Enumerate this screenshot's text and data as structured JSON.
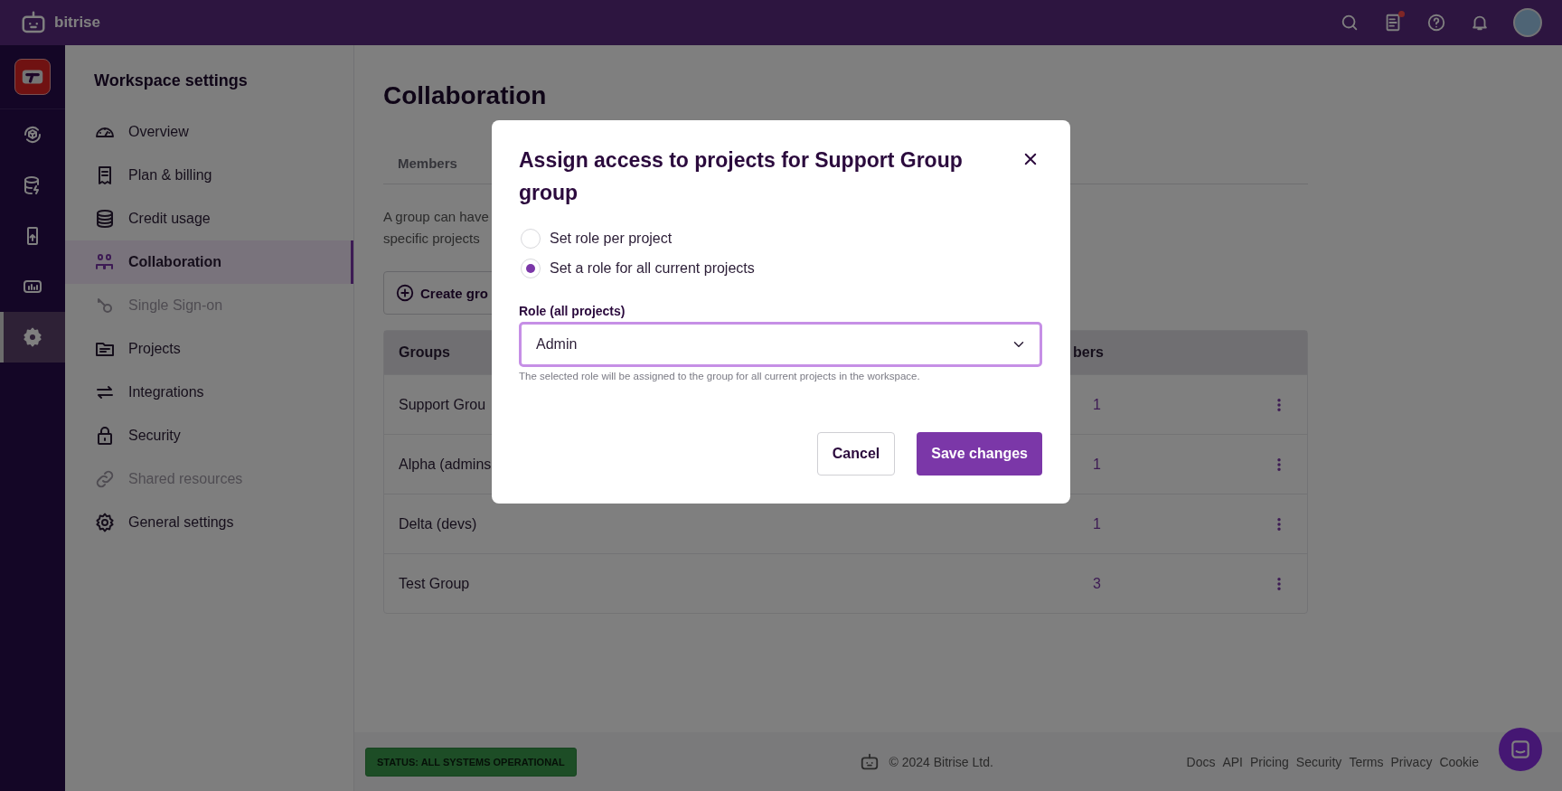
{
  "topbar": {
    "brand": "bitrise",
    "notification_dot": true
  },
  "rail": {
    "items": [
      {
        "selected": false
      },
      {
        "selected": false
      },
      {
        "selected": false
      },
      {
        "selected": false
      },
      {
        "selected": true
      }
    ]
  },
  "sidebar": {
    "title": "Workspace settings",
    "items": [
      {
        "label": "Overview",
        "selected": false,
        "disabled": false
      },
      {
        "label": "Plan & billing",
        "selected": false,
        "disabled": false
      },
      {
        "label": "Credit usage",
        "selected": false,
        "disabled": false
      },
      {
        "label": "Collaboration",
        "selected": true,
        "disabled": false
      },
      {
        "label": "Single Sign-on",
        "selected": false,
        "disabled": true
      },
      {
        "label": "Projects",
        "selected": false,
        "disabled": false
      },
      {
        "label": "Integrations",
        "selected": false,
        "disabled": false
      },
      {
        "label": "Security",
        "selected": false,
        "disabled": false
      },
      {
        "label": "Shared resources",
        "selected": false,
        "disabled": true
      },
      {
        "label": "General settings",
        "selected": false,
        "disabled": false
      }
    ]
  },
  "page": {
    "title": "Collaboration",
    "tabs": [
      {
        "label": "Members",
        "selected": false
      }
    ],
    "description_lines": [
      "A group can have",
      "specific projects"
    ],
    "create_button": "Create gro",
    "table": {
      "columns": [
        "Groups",
        "bers"
      ],
      "rows": [
        {
          "name": "Support Grou",
          "members": "1"
        },
        {
          "name": "Alpha (admins",
          "members": "1"
        },
        {
          "name": "Delta (devs)",
          "members": "1"
        },
        {
          "name": "Test Group",
          "members": "3"
        }
      ]
    }
  },
  "modal": {
    "open": true,
    "title": "Assign access to projects for Support Group group",
    "options": [
      {
        "label": "Set role per project",
        "selected": false
      },
      {
        "label": "Set a role for all current projects",
        "selected": true
      }
    ],
    "role_label": "Role (all projects)",
    "role_value": "Admin",
    "helper": "The selected role will be assigned to the group for all current projects in the workspace.",
    "cancel": "Cancel",
    "save": "Save changes"
  },
  "footer": {
    "status": "STATUS: ALL SYSTEMS OPERATIONAL",
    "copyright": "© 2024 Bitrise Ltd.",
    "links": [
      "Docs",
      "API",
      "Pricing",
      "Security",
      "Terms",
      "Privacy",
      "Cookie"
    ]
  }
}
